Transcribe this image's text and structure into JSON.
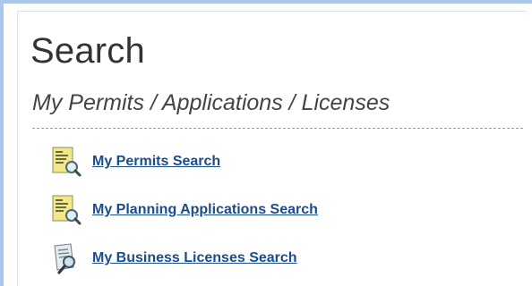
{
  "page": {
    "title": "Search",
    "subtitle": "My Permits / Applications / Licenses"
  },
  "links": [
    {
      "label": "My Permits Search",
      "icon": "document-search-icon"
    },
    {
      "label": "My Planning Applications Search",
      "icon": "document-search-icon"
    },
    {
      "label": "My Business Licenses Search",
      "icon": "license-search-icon"
    }
  ],
  "colors": {
    "frame_border": "#aac8ee",
    "link": "#1a4d8c",
    "title": "#333333"
  }
}
